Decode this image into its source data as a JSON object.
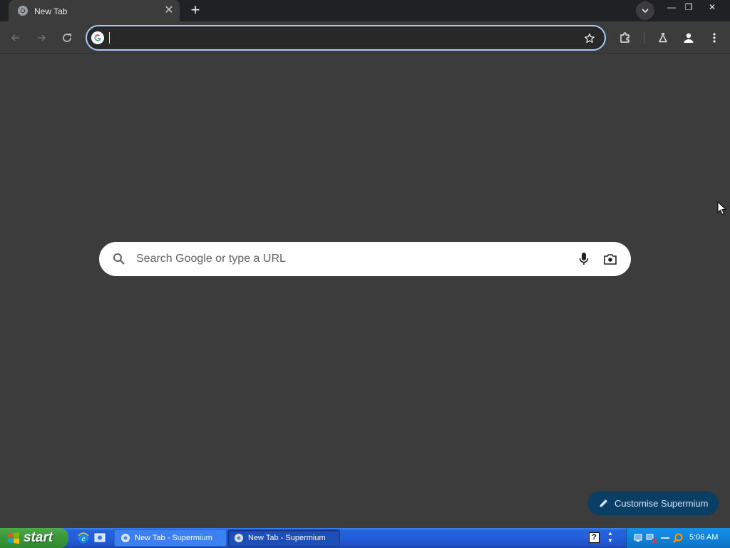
{
  "browser": {
    "tab": {
      "title": "New Tab",
      "close_icon": "close-icon"
    },
    "new_tab_label": "+",
    "omnibox": {
      "value": "",
      "placeholder": ""
    },
    "window_controls": {
      "minimize": "—",
      "restore": "❐",
      "close": "✕"
    }
  },
  "ntp": {
    "search_placeholder": "Search Google or type a URL",
    "customise_label": "Customise Supermium"
  },
  "taskbar": {
    "start_label": "start",
    "tasks": [
      {
        "label": "New Tab - Supermium",
        "active": false
      },
      {
        "label": "New Tab - Supermium",
        "active": true
      }
    ],
    "help_label": "?",
    "clock": "5:06 AM"
  },
  "colors": {
    "page_bg": "#3c3c3c",
    "titlebar_bg": "#202124",
    "omnibox_border": "#a8c7fa",
    "customise_bg": "#0b3e64",
    "taskbar_blue": "#245edb",
    "start_green": "#3c9a3c"
  }
}
